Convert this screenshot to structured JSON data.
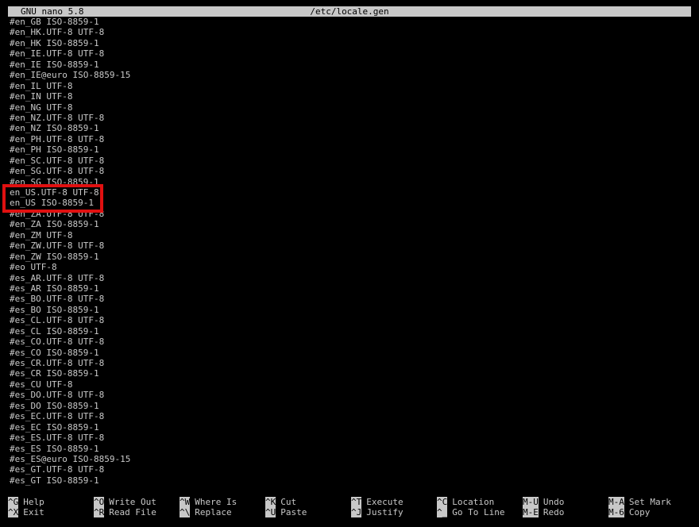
{
  "window": {
    "app_title": "GNU nano 5.8",
    "file_path": "/etc/locale.gen"
  },
  "editor": {
    "lines": [
      "#en_GB ISO-8859-1",
      "#en_HK.UTF-8 UTF-8",
      "#en_HK ISO-8859-1",
      "#en_IE.UTF-8 UTF-8",
      "#en_IE ISO-8859-1",
      "#en_IE@euro ISO-8859-15",
      "#en_IL UTF-8",
      "#en_IN UTF-8",
      "#en_NG UTF-8",
      "#en_NZ.UTF-8 UTF-8",
      "#en_NZ ISO-8859-1",
      "#en_PH.UTF-8 UTF-8",
      "#en_PH ISO-8859-1",
      "#en_SC.UTF-8 UTF-8",
      "#en_SG.UTF-8 UTF-8",
      "#en_SG ISO-8859-1",
      "en_US.UTF-8 UTF-8",
      "en_US ISO-8859-1",
      "#en_ZA.UTF-8 UTF-8",
      "#en_ZA ISO-8859-1",
      "#en_ZM UTF-8",
      "#en_ZW.UTF-8 UTF-8",
      "#en_ZW ISO-8859-1",
      "#eo UTF-8",
      "#es_AR.UTF-8 UTF-8",
      "#es_AR ISO-8859-1",
      "#es_BO.UTF-8 UTF-8",
      "#es_BO ISO-8859-1",
      "#es_CL.UTF-8 UTF-8",
      "#es_CL ISO-8859-1",
      "#es_CO.UTF-8 UTF-8",
      "#es_CO ISO-8859-1",
      "#es_CR.UTF-8 UTF-8",
      "#es_CR ISO-8859-1",
      "#es_CU UTF-8",
      "#es_DO.UTF-8 UTF-8",
      "#es_DO ISO-8859-1",
      "#es_EC.UTF-8 UTF-8",
      "#es_EC ISO-8859-1",
      "#es_ES.UTF-8 UTF-8",
      "#es_ES ISO-8859-1",
      "#es_ES@euro ISO-8859-15",
      "#es_GT.UTF-8 UTF-8",
      "#es_GT ISO-8859-1"
    ],
    "highlight_color": "#e01010"
  },
  "shortcuts": {
    "row1": [
      {
        "key": "^G",
        "label": "Help"
      },
      {
        "key": "^O",
        "label": "Write Out"
      },
      {
        "key": "^W",
        "label": "Where Is"
      },
      {
        "key": "^K",
        "label": "Cut"
      },
      {
        "key": "^T",
        "label": "Execute"
      },
      {
        "key": "^C",
        "label": "Location"
      },
      {
        "key": "M-U",
        "label": "Undo"
      },
      {
        "key": "M-A",
        "label": "Set Mark"
      }
    ],
    "row2": [
      {
        "key": "^X",
        "label": "Exit"
      },
      {
        "key": "^R",
        "label": "Read File"
      },
      {
        "key": "^\\",
        "label": "Replace"
      },
      {
        "key": "^U",
        "label": "Paste"
      },
      {
        "key": "^J",
        "label": "Justify"
      },
      {
        "key": "^_",
        "label": "Go To Line"
      },
      {
        "key": "M-E",
        "label": "Redo"
      },
      {
        "key": "M-6",
        "label": "Copy"
      }
    ]
  },
  "colors": {
    "background": "#000000",
    "foreground": "#c8c8c8",
    "inverse_bg": "#c8c8c8",
    "inverse_fg": "#000000"
  }
}
